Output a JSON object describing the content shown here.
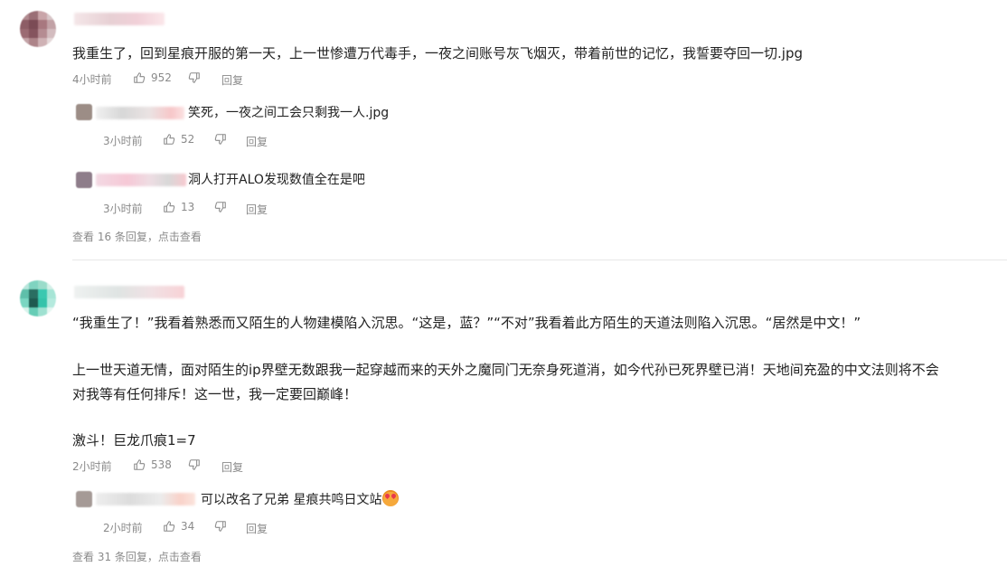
{
  "comments": [
    {
      "text": "我重生了，回到星痕开服的第一天，上一世惨遭万代毒手，一夜之间账号灰飞烟灭，带着前世的记忆，我誓要夺回一切.jpg",
      "time": "4小时前",
      "likes": "952",
      "reply_label": "回复",
      "replies": [
        {
          "text": "笑死，一夜之间工会只剩我一人.jpg",
          "time": "3小时前",
          "likes": "52",
          "reply_label": "回复"
        },
        {
          "text": "洞人打开ALO发现数值全在是吧",
          "time": "3小时前",
          "likes": "13",
          "reply_label": "回复"
        }
      ],
      "view_more": "查看 16 条回复，点击查看"
    },
    {
      "lines": [
        "“我重生了！”我看着熟悉而又陌生的人物建模陷入沉思。“这是，蓝？”“不对”我看着此方陌生的天道法则陷入沉思。“居然是中文！”",
        "上一世天道无情，面对陌生的ip界壁无数跟我一起穿越而来的天外之魔同门无奈身死道消，如今代孙已死界壁已消！天地间充盈的中文法则将不会",
        "对我等有任何排斥！这一世，我一定要回巅峰！",
        "激斗！巨龙爪痕1=7"
      ],
      "time": "2小时前",
      "likes": "538",
      "reply_label": "回复",
      "replies": [
        {
          "text": "可以改名了兄弟 星痕共鸣日文站",
          "time": "2小时前",
          "likes": "34",
          "reply_label": "回复"
        }
      ],
      "view_more": "查看 31 条回复，点击查看"
    }
  ],
  "icons": {
    "like": "thumbs-up-icon",
    "dislike": "thumbs-down-icon",
    "emoji": "heart-eyes-emoji-icon"
  },
  "colors": {
    "meta": "#8a8a8a",
    "text": "#222222",
    "divider": "#e8e8e8"
  }
}
